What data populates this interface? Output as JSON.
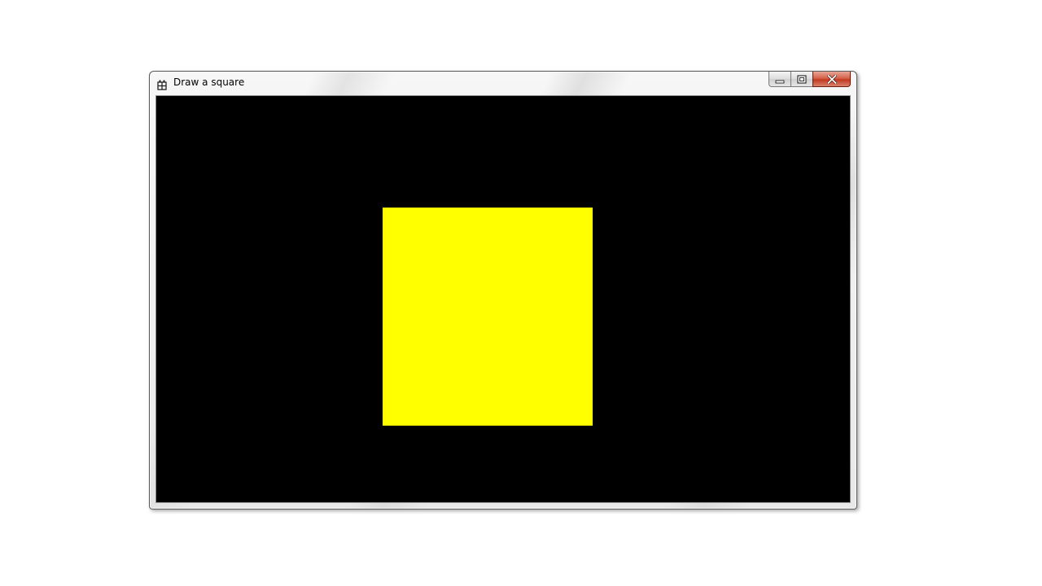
{
  "window": {
    "title": "Draw a square",
    "app_icon": "application-icon",
    "caption_buttons": {
      "minimize_icon": "minimize-icon",
      "maximize_icon": "maximize-icon",
      "close_icon": "close-icon"
    }
  },
  "canvas": {
    "background_color": "#000000",
    "shape": {
      "type": "square",
      "fill_color": "#ffff00"
    }
  }
}
